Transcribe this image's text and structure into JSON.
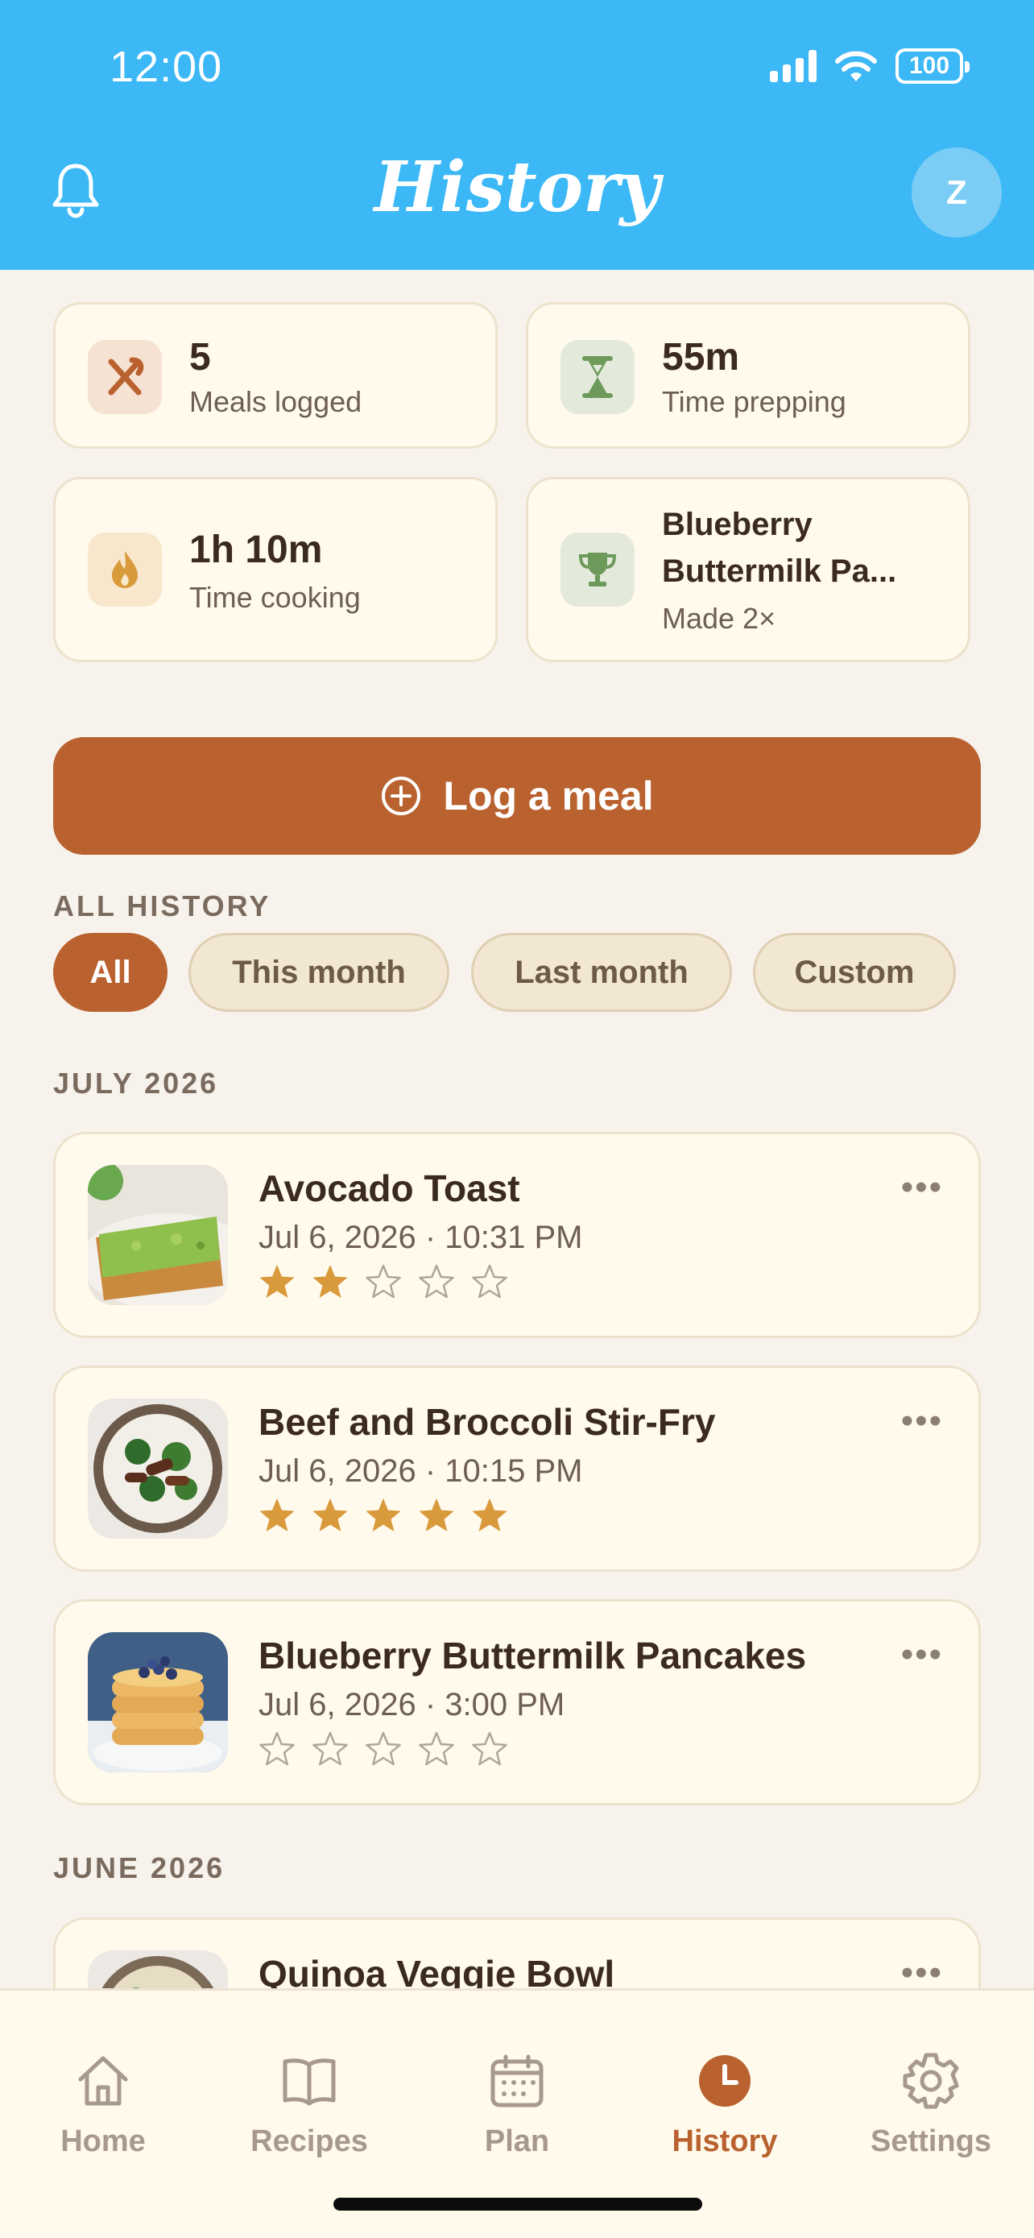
{
  "status_bar": {
    "time": "12:00",
    "battery": "100"
  },
  "header": {
    "title": "History",
    "avatar_initial": "Z"
  },
  "stats": [
    {
      "value": "5",
      "label": "Meals logged",
      "icon": "utensils-icon"
    },
    {
      "value": "55m",
      "label": "Time prepping",
      "icon": "hourglass-icon"
    },
    {
      "value": "1h 10m",
      "label": "Time cooking",
      "icon": "flame-icon"
    },
    {
      "value_line1": "Blueberry",
      "value_line2": "Buttermilk Pa...",
      "label": "Made 2×",
      "icon": "trophy-icon"
    }
  ],
  "log_button": {
    "label": "Log a meal"
  },
  "filters": {
    "section_label": "ALL HISTORY",
    "chips": [
      "All",
      "This month",
      "Last month",
      "Custom"
    ],
    "selected": "All"
  },
  "groups": [
    {
      "label": "JULY 2026",
      "meals": [
        {
          "name": "Avocado Toast",
          "date": "Jul 6, 2026 · 10:31 PM",
          "rating": 2
        },
        {
          "name": "Beef and Broccoli Stir-Fry",
          "date": "Jul 6, 2026 · 10:15 PM",
          "rating": 5
        },
        {
          "name": "Blueberry Buttermilk Pancakes",
          "date": "Jul 6, 2026 · 3:00 PM",
          "rating": 0
        }
      ]
    },
    {
      "label": "JUNE 2026",
      "meals": [
        {
          "name": "Quinoa Veggie Bowl"
        }
      ]
    }
  ],
  "more_glyph": "•••",
  "tabs": [
    {
      "label": "Home",
      "icon": "home-icon"
    },
    {
      "label": "Recipes",
      "icon": "book-icon"
    },
    {
      "label": "Plan",
      "icon": "calendar-icon"
    },
    {
      "label": "History",
      "icon": "clock-icon",
      "active": true
    },
    {
      "label": "Settings",
      "icon": "gear-icon"
    }
  ],
  "colors": {
    "header": "#3bb8f5",
    "accent": "#b9622f",
    "star": "#d99a3c",
    "background": "#f7f3ec"
  }
}
